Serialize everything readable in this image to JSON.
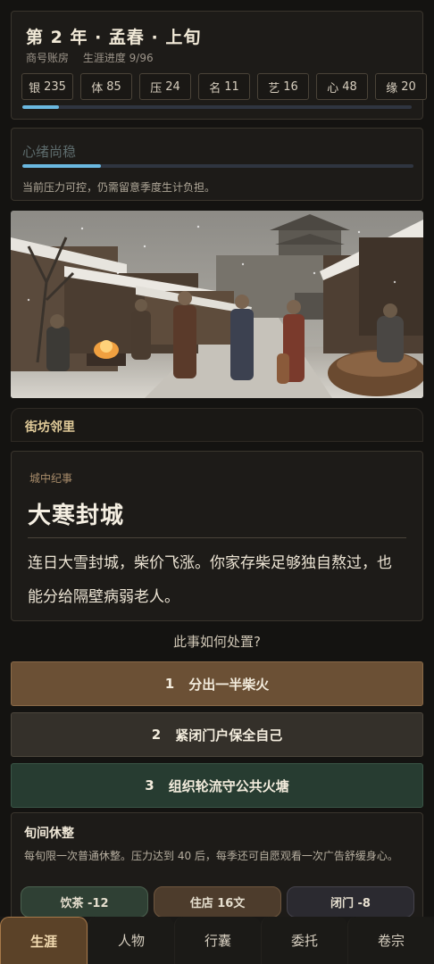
{
  "header": {
    "title": "第 2 年 · 孟春 · 上旬",
    "shop": "商号账房",
    "progress_text": "生涯进度 9/96",
    "progress": 0.094,
    "stats": [
      {
        "label": "银",
        "value": "235"
      },
      {
        "label": "体",
        "value": "85"
      },
      {
        "label": "压",
        "value": "24"
      },
      {
        "label": "名",
        "value": "11"
      },
      {
        "label": "艺",
        "value": "16"
      },
      {
        "label": "心",
        "value": "48"
      },
      {
        "label": "缘",
        "value": "20"
      }
    ]
  },
  "mood": {
    "title": "心绪尚稳",
    "level": 0.2,
    "description": "当前压力可控，仍需留意季度生计负担。"
  },
  "location": "街坊邻里",
  "event": {
    "tag": "城中纪事",
    "title": "大寒封城",
    "body": "连日大雪封城，柴价飞涨。你家存柴足够独自熬过，也能分给隔壁病弱老人。"
  },
  "question": "此事如何处置?",
  "choices": [
    {
      "num": "1",
      "label": "分出一半柴火"
    },
    {
      "num": "2",
      "label": "紧闭门户保全自己"
    },
    {
      "num": "3",
      "label": "组织轮流守公共火塘"
    }
  ],
  "rest": {
    "title": "旬间休整",
    "description": "每旬限一次普通休整。压力达到 40 后，每季还可自愿观看一次广告舒缓身心。",
    "buttons": [
      "饮茶 -12",
      "住店 16文",
      "闭门 -8"
    ]
  },
  "nav": [
    "生涯",
    "人物",
    "行囊",
    "委托",
    "卷宗"
  ],
  "colors": {
    "accent": "#6ab8e0",
    "active_tab": "#5b4228",
    "choice_primary": "#6b5035",
    "choice_green": "#273c31"
  }
}
